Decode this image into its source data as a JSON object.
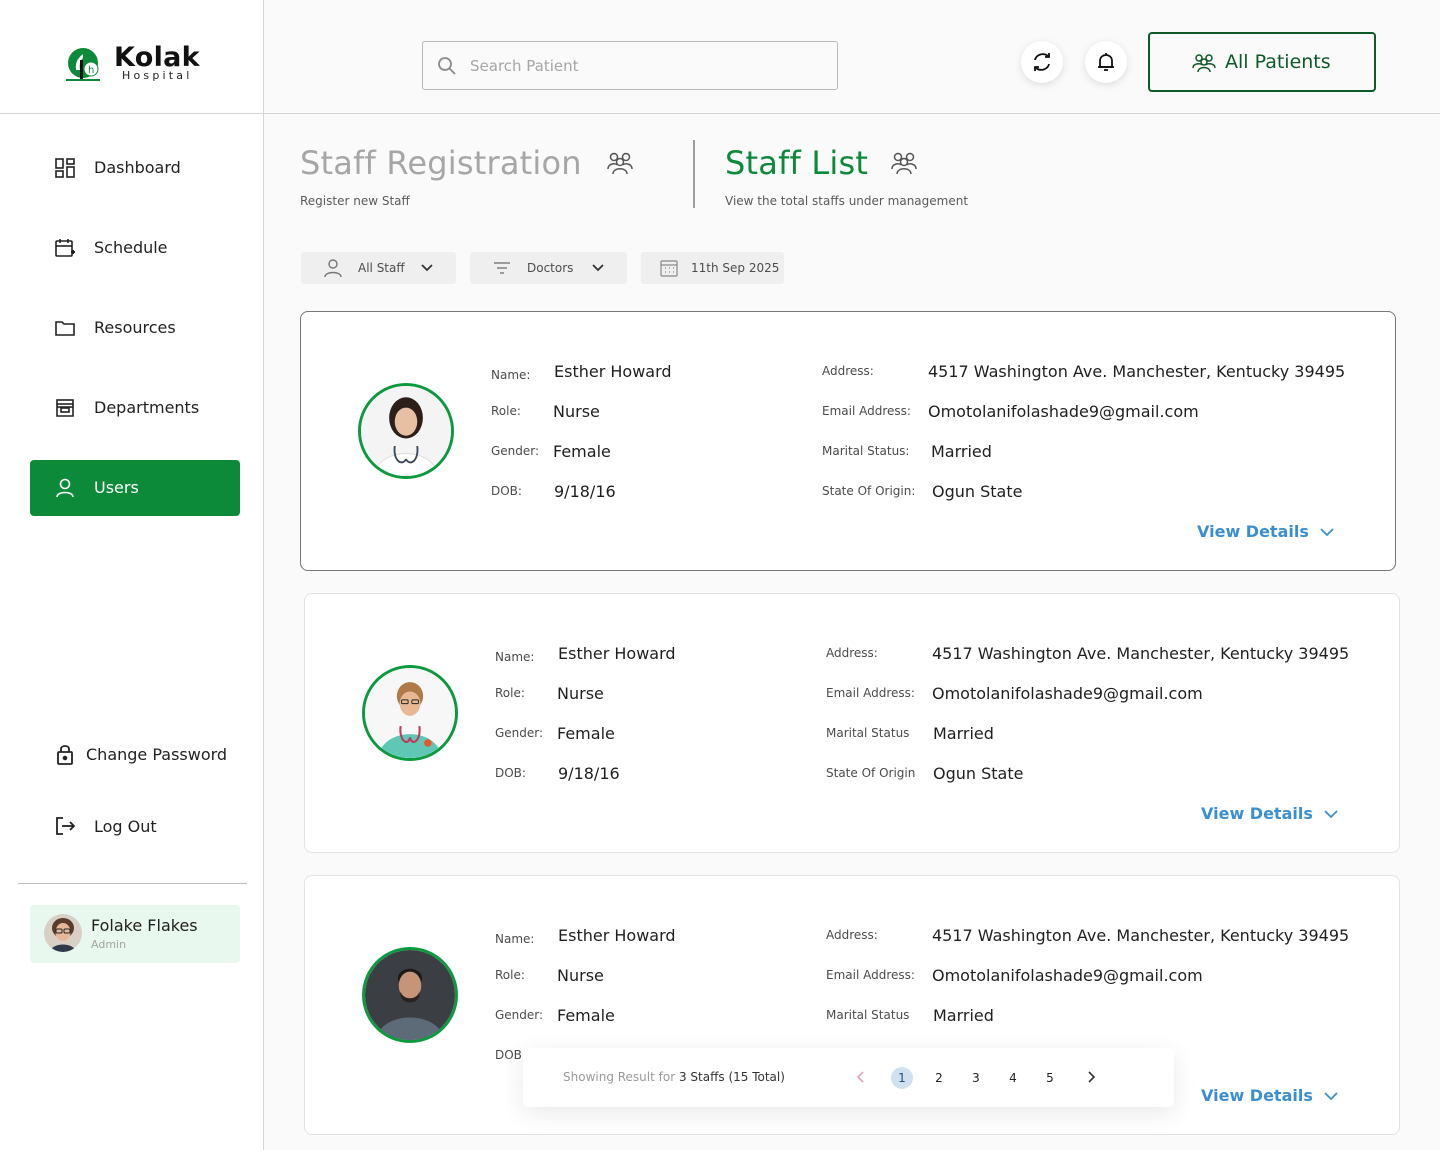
{
  "app": {
    "brand_name": "Kolak",
    "brand_sub": "Hospital"
  },
  "sidebar": {
    "items": [
      {
        "label": "Dashboard",
        "icon": "dashboard-icon"
      },
      {
        "label": "Schedule",
        "icon": "calendar-add-icon"
      },
      {
        "label": "Resources",
        "icon": "folder-icon"
      },
      {
        "label": "Departments",
        "icon": "store-icon"
      },
      {
        "label": "Users",
        "icon": "user-icon",
        "active": true
      }
    ],
    "change_password": "Change Password",
    "logout": "Log Out",
    "profile": {
      "name": "Folake Flakes",
      "role": "Admin"
    }
  },
  "header": {
    "search_placeholder": "Search Patient",
    "all_patients_label": "All Patients"
  },
  "tabs": [
    {
      "title": "Staff Registration",
      "subtitle": "Register new Staff",
      "active": false
    },
    {
      "title": "Staff List",
      "subtitle": "View the total staffs under management",
      "active": true
    }
  ],
  "filters": [
    {
      "label": "All Staff",
      "icon": "user-icon"
    },
    {
      "label": "Doctors",
      "icon": "filter-icon"
    },
    {
      "label": "11th Sep 2025",
      "icon": "calendar-icon"
    }
  ],
  "labels": {
    "name": "Name:",
    "role": "Role:",
    "gender": "Gender:",
    "dob": "DOB:",
    "address": "Address:",
    "email": "Email Address:",
    "marital_colon": "Marital Status:",
    "origin_colon": "State Of Origin:",
    "marital": "Marital Status",
    "origin": "State Of Origin",
    "view_details": "View Details"
  },
  "staff": [
    {
      "name": "Esther Howard",
      "role": "Nurse",
      "gender": "Female",
      "dob": "9/18/16",
      "address": "4517 Washington Ave. Manchester, Kentucky 39495",
      "email": "Omotolanifolashade9@gmail.com",
      "marital": "Married",
      "origin": "Ogun State"
    },
    {
      "name": "Esther Howard",
      "role": "Nurse",
      "gender": "Female",
      "dob": "9/18/16",
      "address": "4517 Washington Ave. Manchester, Kentucky 39495",
      "email": "Omotolanifolashade9@gmail.com",
      "marital": "Married",
      "origin": "Ogun State"
    },
    {
      "name": "Esther Howard",
      "role": "Nurse",
      "gender": "Female",
      "dob": "",
      "address": "4517 Washington Ave. Manchester, Kentucky 39495",
      "email": "Omotolanifolashade9@gmail.com",
      "marital": "Married",
      "origin": ""
    }
  ],
  "pagination": {
    "prefix": "Showing Result for",
    "count": "3 Staffs (15 Total)",
    "pages": [
      "1",
      "2",
      "3",
      "4",
      "5"
    ],
    "current": "1"
  },
  "colors": {
    "brand_green": "#0c8a3a",
    "dark_green": "#0c5a26",
    "link_blue": "#3b8fd0",
    "muted_title": "#a6a6a6"
  }
}
